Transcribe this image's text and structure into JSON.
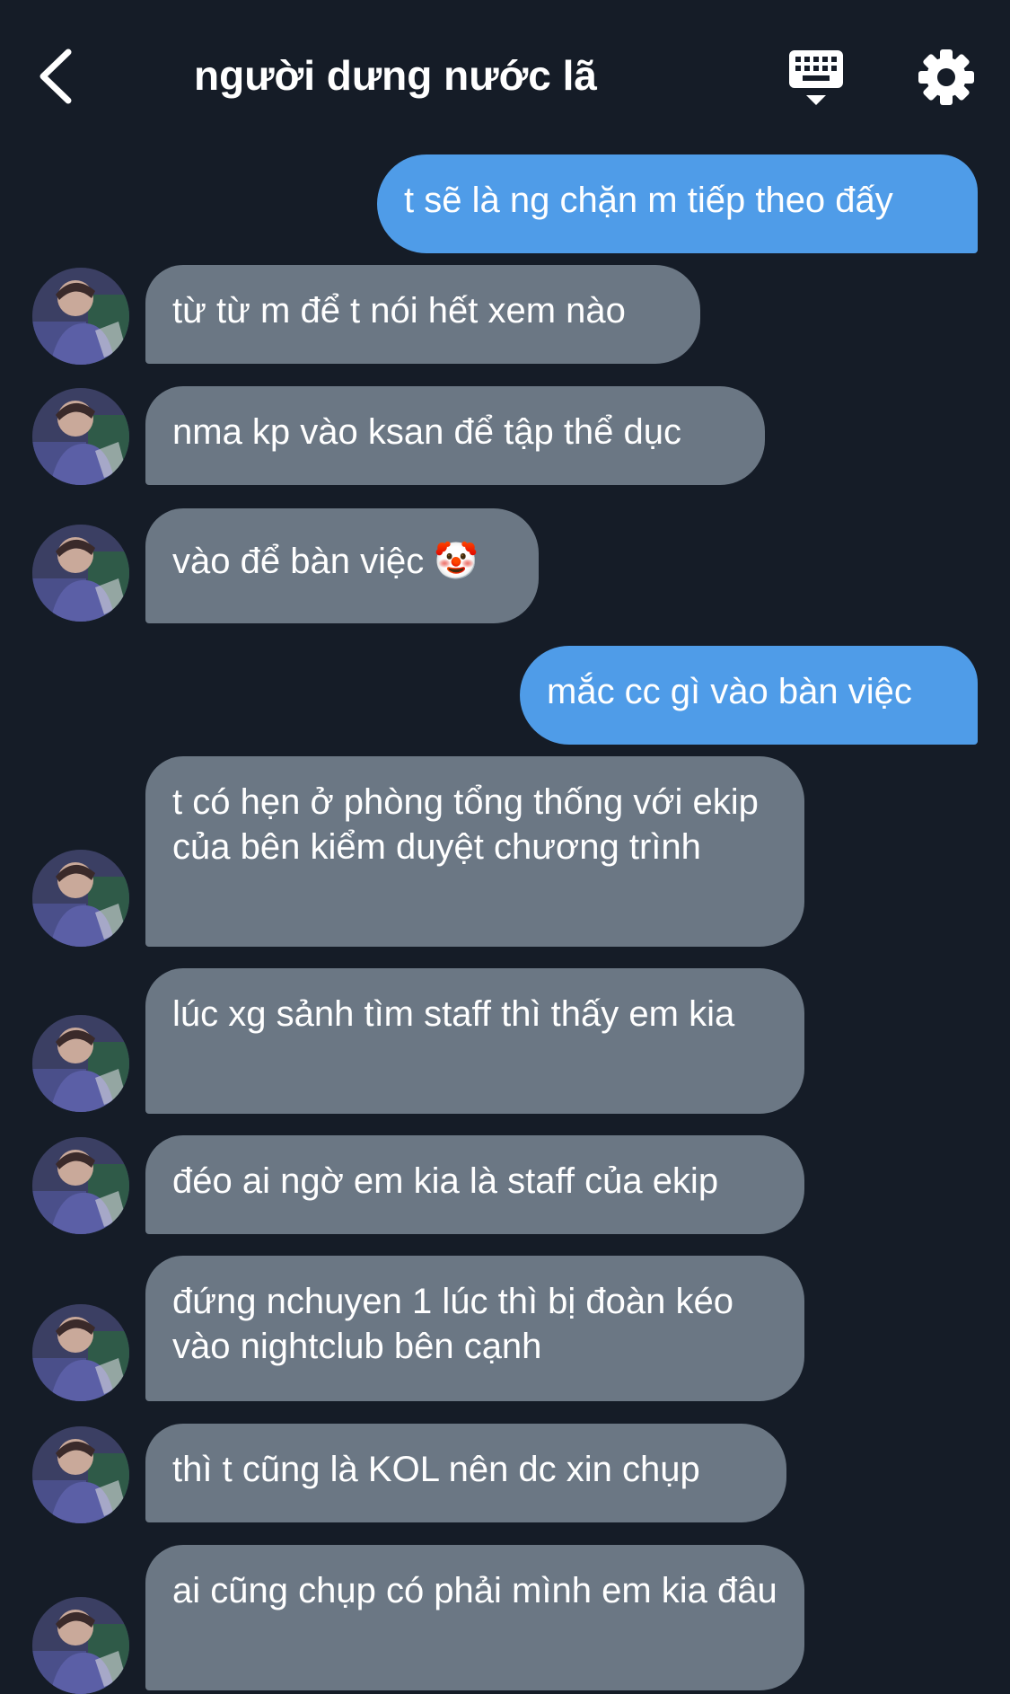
{
  "header": {
    "title": "người dưng nước lã",
    "back_icon": "chevron-left-icon",
    "keyboard_icon": "keyboard-icon",
    "settings_icon": "gear-icon"
  },
  "colors": {
    "background": "#151c27",
    "outgoing_bubble": "#4f9ce8",
    "incoming_bubble": "#6b7784",
    "text": "#ffffff"
  },
  "messages": [
    {
      "direction": "out",
      "text": "t sẽ là ng chặn m tiếp theo đấy"
    },
    {
      "direction": "in",
      "text": "từ từ m để t nói hết xem nào"
    },
    {
      "direction": "in",
      "text": "nma kp vào ksan để tập thể dục"
    },
    {
      "direction": "in",
      "text": "vào để bàn việc 🤡"
    },
    {
      "direction": "out",
      "text": "mắc cc gì vào bàn việc"
    },
    {
      "direction": "in",
      "text": "t có hẹn ở phòng tổng thống với ekip của bên kiểm duyệt chương trình"
    },
    {
      "direction": "in",
      "text": "lúc xg sảnh tìm staff thì thấy em kia"
    },
    {
      "direction": "in",
      "text": "đéo ai ngờ em kia là staff của ekip"
    },
    {
      "direction": "in",
      "text": "đứng nchuyen 1 lúc thì bị đoàn kéo vào nightclub bên cạnh"
    },
    {
      "direction": "in",
      "text": "thì t cũng là KOL nên dc xin chụp"
    },
    {
      "direction": "in",
      "text": "ai cũng chụp có phải mình em kia đâu"
    }
  ]
}
